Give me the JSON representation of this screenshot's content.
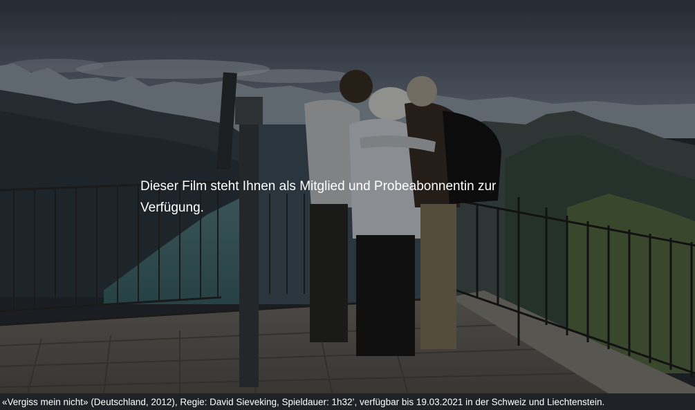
{
  "video": {
    "message": "Dieser Film steht Ihnen als Mitglied und Probeabonnentin zur Verfügung.",
    "scene_description_icon": "film-still-image"
  },
  "caption": {
    "text": "«Vergiss mein nicht» (Deutschland, 2012), Regie: David Sieveking, Spieldauer: 1h32’, verfügbar bis 19.03.2021 in der Schweiz und Liechtenstein."
  },
  "colors": {
    "overlay_text": "#ffffff",
    "caption_background": "#1f2327"
  }
}
